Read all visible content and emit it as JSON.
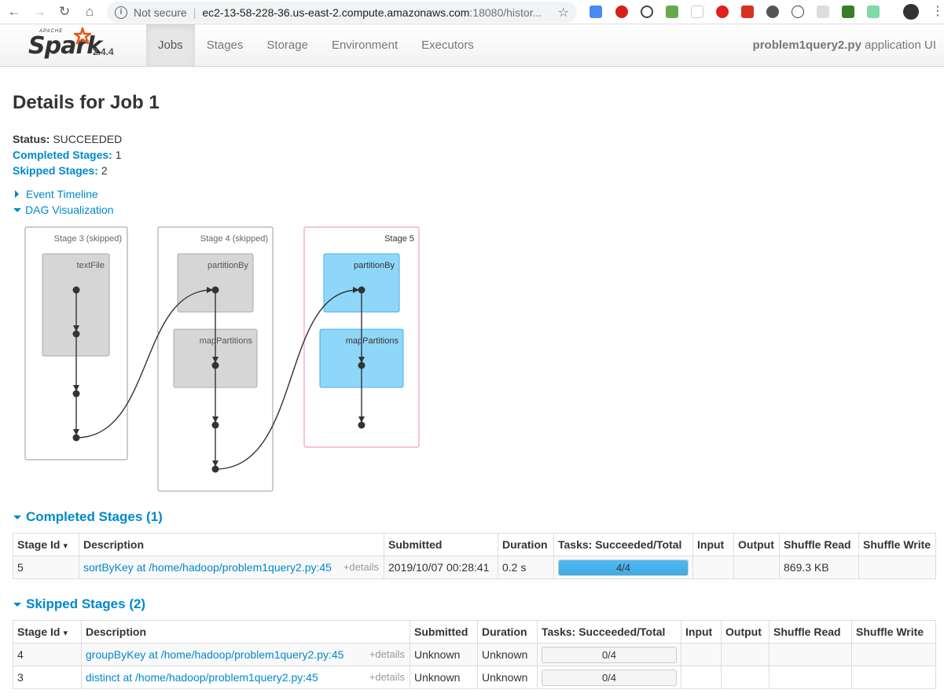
{
  "browser": {
    "security_label": "Not secure",
    "url_host": "ec2-13-58-228-36.us-east-2.compute.amazonaws.com",
    "url_rest": ":18080/histor..."
  },
  "navbar": {
    "logo_apache": "APACHE",
    "logo_spark": "Spark",
    "version": "2.4.4",
    "tabs": [
      {
        "label": "Jobs"
      },
      {
        "label": "Stages"
      },
      {
        "label": "Storage"
      },
      {
        "label": "Environment"
      },
      {
        "label": "Executors"
      }
    ],
    "app_name": "problem1query2.py",
    "app_suffix": " application UI"
  },
  "job": {
    "title": "Details for Job 1",
    "status_label": "Status:",
    "status_value": "SUCCEEDED",
    "completed_label": "Completed Stages:",
    "completed_value": "1",
    "skipped_label": "Skipped Stages:",
    "skipped_value": "2",
    "event_timeline": "Event Timeline",
    "dag_visualization": "DAG Visualization"
  },
  "dag": {
    "stages": [
      {
        "label": "Stage 3 (skipped)",
        "ops": [
          "textFile"
        ]
      },
      {
        "label": "Stage 4 (skipped)",
        "ops": [
          "partitionBy",
          "mapPartitions"
        ]
      },
      {
        "label": "Stage 5",
        "ops": [
          "partitionBy",
          "mapPartitions"
        ]
      }
    ]
  },
  "completed": {
    "heading": "Completed Stages (1)",
    "columns": [
      "Stage Id",
      "Description",
      "Submitted",
      "Duration",
      "Tasks: Succeeded/Total",
      "Input",
      "Output",
      "Shuffle Read",
      "Shuffle Write"
    ],
    "rows": [
      {
        "id": "5",
        "desc": "sortByKey at /home/hadoop/problem1query2.py:45",
        "details": "+details",
        "submitted": "2019/10/07 00:28:41",
        "duration": "0.2 s",
        "tasks": "4/4",
        "progress": 1.0,
        "input": "",
        "output": "",
        "shuffle_read": "869.3 KB",
        "shuffle_write": ""
      }
    ]
  },
  "skipped": {
    "heading": "Skipped Stages (2)",
    "columns": [
      "Stage Id",
      "Description",
      "Submitted",
      "Duration",
      "Tasks: Succeeded/Total",
      "Input",
      "Output",
      "Shuffle Read",
      "Shuffle Write"
    ],
    "rows": [
      {
        "id": "4",
        "desc": "groupByKey at /home/hadoop/problem1query2.py:45",
        "details": "+details",
        "submitted": "Unknown",
        "duration": "Unknown",
        "tasks": "0/4",
        "progress": 0.0,
        "input": "",
        "output": "",
        "shuffle_read": "",
        "shuffle_write": ""
      },
      {
        "id": "3",
        "desc": "distinct at /home/hadoop/problem1query2.py:45",
        "details": "+details",
        "submitted": "Unknown",
        "duration": "Unknown",
        "tasks": "0/4",
        "progress": 0.0,
        "input": "",
        "output": "",
        "shuffle_read": "",
        "shuffle_write": ""
      }
    ]
  },
  "sort_indicator": "▾",
  "colors": {
    "link": "#0088cc",
    "dag_active": "#8fd7f9",
    "dag_skipped": "#d6d6d6",
    "stage5_border": "#f29fc0"
  }
}
